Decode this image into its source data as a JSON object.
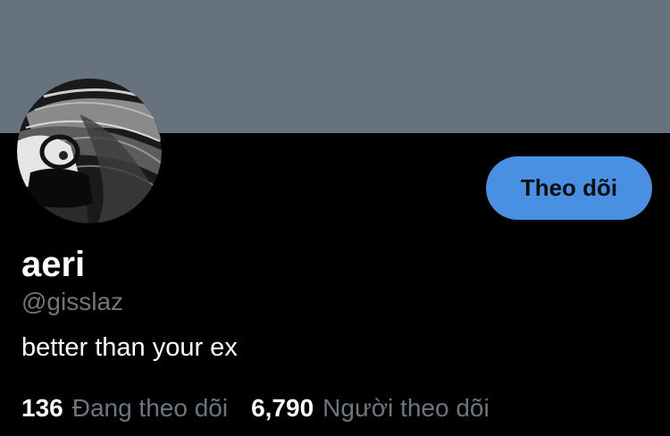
{
  "profile": {
    "display_name": "aeri",
    "handle": "@gisslaz",
    "bio": "better than your ex"
  },
  "actions": {
    "follow_label": "Theo dõi"
  },
  "stats": {
    "following_count": "136",
    "following_label": "Đang theo dõi",
    "followers_count": "6,790",
    "followers_label": "Người theo dõi"
  },
  "colors": {
    "banner": "#66737f",
    "background": "#000000",
    "accent": "#4a90e2",
    "secondary_text": "#6e767d"
  }
}
